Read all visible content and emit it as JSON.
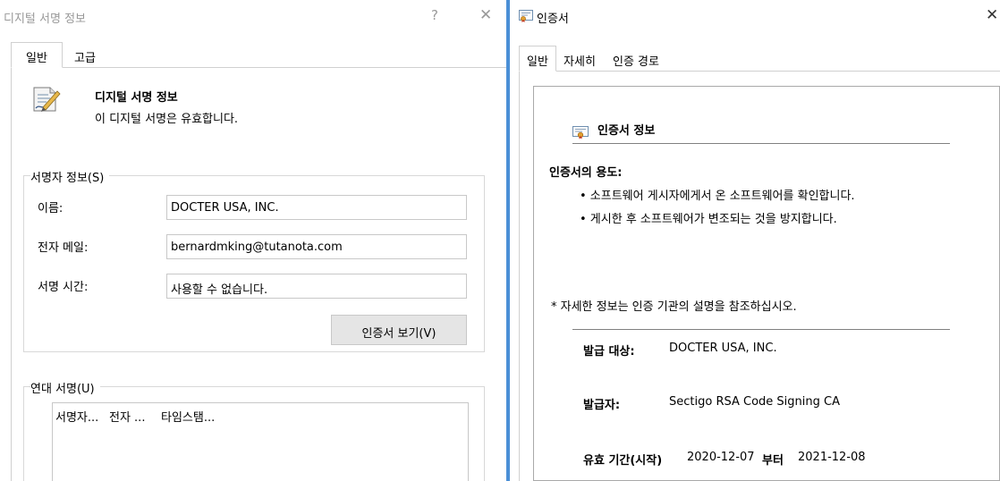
{
  "signature_window": {
    "title": "디지털 서명 정보",
    "help_glyph": "?",
    "close_glyph": "✕",
    "tabs": [
      {
        "label": "일반",
        "active": true
      },
      {
        "label": "고급",
        "active": false
      }
    ],
    "info": {
      "heading": "디지털 서명 정보",
      "status": "이 디지털 서명은 유효합니다."
    },
    "signer_info": {
      "legend": "서명자 정보(S)",
      "name_label": "이름:",
      "name_value": "DOCTER USA, INC.",
      "email_label": "전자 메일:",
      "email_value": "bernardmking@tutanota.com",
      "time_label": "서명 시간:",
      "time_value": "사용할 수 없습니다.",
      "view_cert_button": "인증서 보기(V)"
    },
    "countersignatures": {
      "legend": "연대 서명(U)",
      "columns": [
        "서명자...",
        "전자 ...",
        "타임스탬..."
      ]
    }
  },
  "certificate_window": {
    "title": "인증서",
    "close_glyph": "✕",
    "tabs": [
      {
        "label": "일반",
        "active": true
      },
      {
        "label": "자세히",
        "active": false
      },
      {
        "label": "인증 경로",
        "active": false
      }
    ],
    "info_heading": "인증서 정보",
    "purpose_heading": "인증서의 용도:",
    "purposes": [
      "• 소프트웨어 게시자에게서 온 소프트웨어를 확인합니다.",
      "• 게시한 후 소프트웨어가 변조되는 것을 방지합니다."
    ],
    "ca_note": "* 자세한 정보는 인증 기관의 설명을 참조하십시오.",
    "issued_to_label": "발급 대상:",
    "issued_to_value": "DOCTER USA, INC.",
    "issued_by_label": "발급자:",
    "issued_by_value": "Sectigo RSA Code Signing CA",
    "validity_label": "유효 기간(시작)",
    "valid_from": "2020-12-07",
    "valid_to_word": "부터",
    "valid_to": "2021-12-08"
  },
  "colors": {
    "window_divider": "#4a8fd6",
    "button_face": "#e5e5e5",
    "title_text_inactive": "#999999"
  },
  "icons": {
    "signature_document": "document-pen-icon",
    "certificate": "certificate-icon"
  }
}
